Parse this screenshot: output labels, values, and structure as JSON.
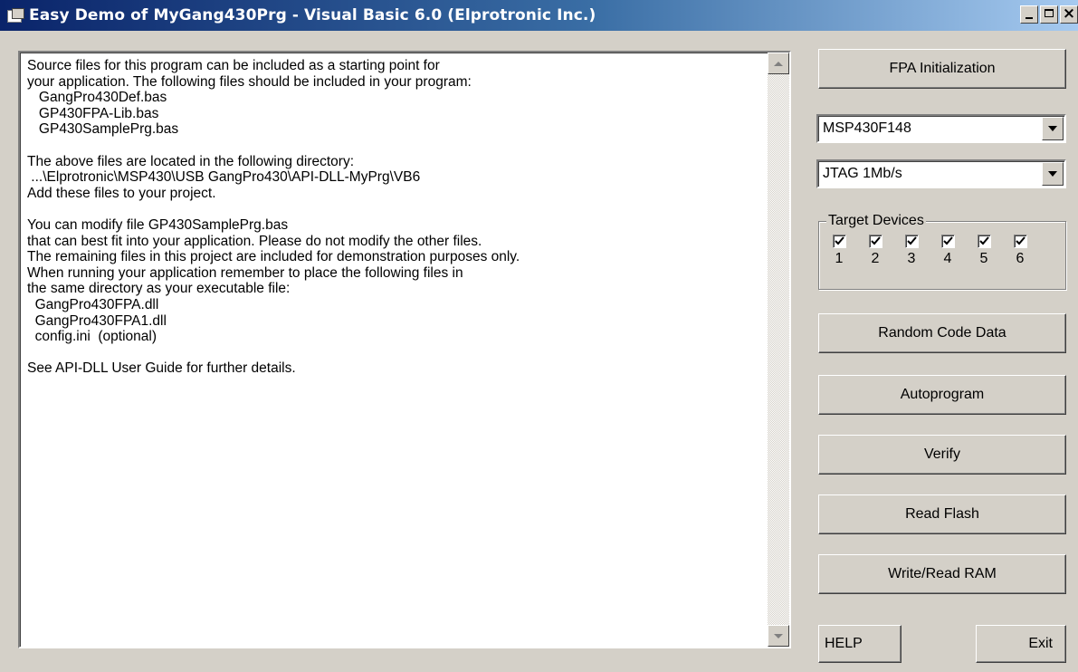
{
  "window": {
    "title": "Easy Demo of MyGang430Prg - Visual Basic 6.0  (Elprotronic Inc.)",
    "minimize_symbol": "",
    "maximize_symbol": "",
    "close_symbol": "×"
  },
  "info_text": "Source files for this program can be included as a starting point for\nyour application. The following files should be included in your program:\n   GangPro430Def.bas\n   GP430FPA-Lib.bas\n   GP430SamplePrg.bas\n\nThe above files are located in the following directory:\n ...\\Elprotronic\\MSP430\\USB GangPro430\\API-DLL-MyPrg\\VB6\nAdd these files to your project.\n\nYou can modify file GP430SamplePrg.bas\nthat can best fit into your application. Please do not modify the other files.\nThe remaining files in this project are included for demonstration purposes only.\nWhen running your application remember to place the following files in\nthe same directory as your executable file:\n  GangPro430FPA.dll\n  GangPro430FPA1.dll\n  config.ini  (optional)\n\nSee API-DLL User Guide for further details.",
  "controls": {
    "fpa_init_label": "FPA Initialization",
    "device_select": "MSP430F148",
    "interface_select": "JTAG 1Mb/s",
    "target_devices_label": "Target Devices",
    "target_devices": [
      {
        "number": "1",
        "checked": true
      },
      {
        "number": "2",
        "checked": true
      },
      {
        "number": "3",
        "checked": true
      },
      {
        "number": "4",
        "checked": true
      },
      {
        "number": "5",
        "checked": true
      },
      {
        "number": "6",
        "checked": true
      }
    ],
    "random_code_label": "Random Code Data",
    "autoprogram_label": "Autoprogram",
    "verify_label": "Verify",
    "read_flash_label": "Read Flash",
    "write_read_ram_label": "Write/Read RAM",
    "help_label": "HELP",
    "exit_label": "Exit"
  },
  "colors": {
    "window_bg": "#d4d0c8",
    "title_start": "#0a246a",
    "title_end": "#a6caf0"
  }
}
